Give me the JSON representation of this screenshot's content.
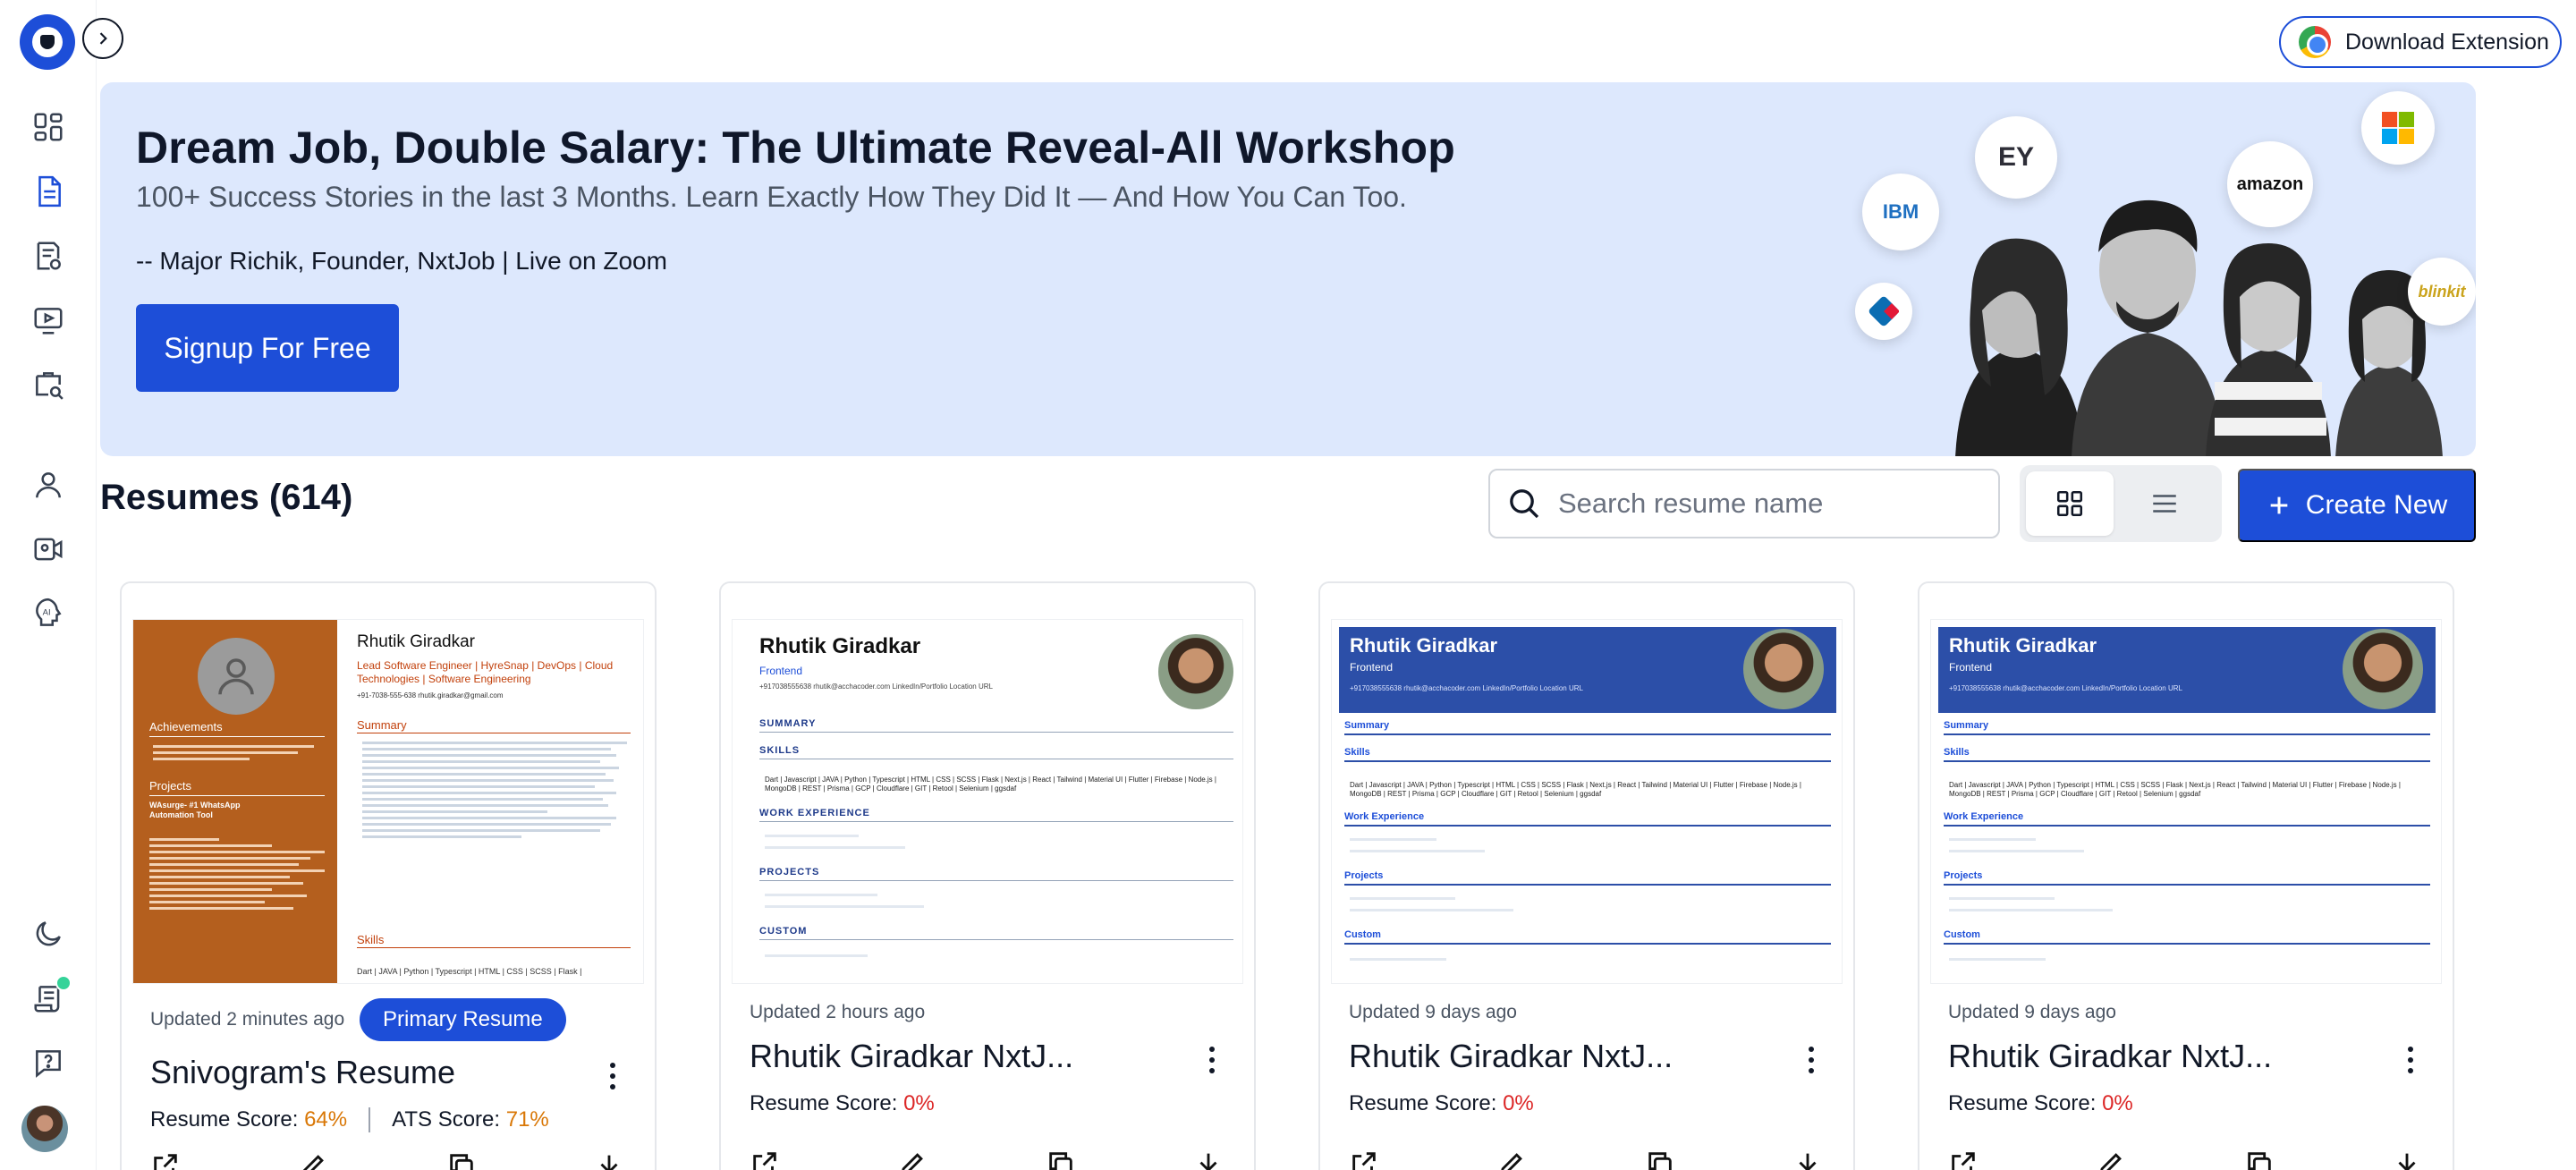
{
  "header": {
    "download_extension": "Download Extension"
  },
  "banner": {
    "title": "Dream Job, Double Salary: The Ultimate Reveal-All Workshop",
    "subtitle": "100+ Success Stories in the last 3 Months. Learn Exactly How They Did It — And How You Can Too.",
    "host": "-- Major Richik, Founder, NxtJob | Live on Zoom",
    "cta": "Signup For Free",
    "brands": [
      "IBM",
      "EY",
      "amazon",
      "microsoft",
      "dominos",
      "blinkit"
    ]
  },
  "resumes": {
    "title": "Resumes (614)",
    "search_placeholder": "Search resume name",
    "create_label": "Create New",
    "cards": [
      {
        "updated": "Updated 2 minutes ago",
        "badge": "Primary Resume",
        "name": "Snivogram's Resume",
        "score_label": "Resume Score:",
        "score": "64%",
        "ats_label": "ATS Score:",
        "ats": "71%",
        "thumb": {
          "name": "Rhutik Giradkar",
          "headline": "Lead Software Engineer | HyreSnap | DevOps | Cloud Technologies | Software Engineering",
          "contact": "+91-7038-555-638    rhutik.giradkar@gmail.com",
          "left_sections": [
            "Achievements",
            "Projects"
          ],
          "project": "WAsurge- #1 WhatsApp Automation Tool",
          "right_sections": [
            "Summary",
            "Skills"
          ],
          "skills_line": "Dart | JAVA | Python | Typescript | HTML | CSS | SCSS | Flask |"
        }
      },
      {
        "updated": "Updated 2 hours ago",
        "name": "Rhutik Giradkar NxtJ...",
        "score_label": "Resume Score:",
        "score": "0%",
        "thumb": {
          "name": "Rhutik Giradkar",
          "role": "Frontend",
          "contact": "+917038555638   rhutik@acchacoder.com   LinkedIn/Portfolio   Location   URL",
          "sections": [
            "SUMMARY",
            "SKILLS",
            "WORK EXPERIENCE",
            "PROJECTS",
            "CUSTOM"
          ],
          "skills": "Dart | Javascript | JAVA | Python | Typescript | HTML | CSS | SCSS | Flask | Next.js | React | Tailwind | Material UI | Flutter | Firebase | Node.js | MongoDB | REST | Prisma | GCP | Cloudflare | GIT | Retool | Selenium | ggsdaf"
        }
      },
      {
        "updated": "Updated 9 days ago",
        "name": "Rhutik Giradkar NxtJ...",
        "score_label": "Resume Score:",
        "score": "0%",
        "thumb": {
          "name": "Rhutik Giradkar",
          "role": "Frontend",
          "contact": "+917038555638   rhutik@acchacoder.com   LinkedIn/Portfolio   Location   URL",
          "sections": [
            "Summary",
            "Skills",
            "Work Experience",
            "Projects",
            "Custom"
          ],
          "skills": "Dart | Javascript | JAVA | Python | Typescript | HTML | CSS | SCSS | Flask | Next.js | React | Tailwind | Material UI | Flutter | Firebase | Node.js | MongoDB | REST | Prisma | GCP | Cloudflare | GIT | Retool | Selenium | ggsdaf"
        }
      },
      {
        "updated": "Updated 9 days ago",
        "name": "Rhutik Giradkar NxtJ...",
        "score_label": "Resume Score:",
        "score": "0%",
        "thumb": {
          "name": "Rhutik Giradkar",
          "role": "Frontend",
          "contact": "+917038555638   rhutik@acchacoder.com   LinkedIn/Portfolio   Location   URL",
          "sections": [
            "Summary",
            "Skills",
            "Work Experience",
            "Projects",
            "Custom"
          ],
          "skills": "Dart | Javascript | JAVA | Python | Typescript | HTML | CSS | SCSS | Flask | Next.js | React | Tailwind | Material UI | Flutter | Firebase | Node.js | MongoDB | REST | Prisma | GCP | Cloudflare | GIT | Retool | Selenium | ggsdaf"
        }
      }
    ]
  },
  "colors": {
    "accent": "#1d4ed8",
    "banner_bg": "#dde8fd",
    "score_orange": "#d97706",
    "score_red": "#dc2626",
    "thumb_orange": "#b45f1e"
  },
  "sidebar": {
    "icons": [
      "dashboard-icon",
      "resume-icon",
      "cover-letter-icon",
      "video-icon",
      "job-search-icon",
      "profile-icon",
      "interview-icon",
      "ai-icon",
      "dark-mode-icon",
      "scroll-icon",
      "help-icon"
    ]
  }
}
